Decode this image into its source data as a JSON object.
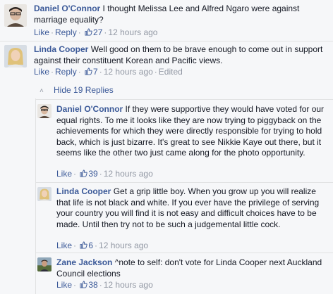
{
  "comments": [
    {
      "author": "Daniel O'Connor",
      "text": "I thought Melissa Lee and Alfred Ngaro were against marriage equality?",
      "like_label": "Like",
      "reply_label": "Reply",
      "likes": "27",
      "time": "12 hours ago"
    },
    {
      "author": "Linda Cooper",
      "text": "Well good on them to be brave enough to come out in support against their constituent Korean and Pacific views.",
      "like_label": "Like",
      "reply_label": "Reply",
      "likes": "7",
      "time": "12 hours ago",
      "edited": "Edited"
    }
  ],
  "hide_replies_label": "Hide 19 Replies",
  "replies": [
    {
      "author": "Daniel O'Connor",
      "text": "If they were supportive they would have voted for our equal rights. To me it looks like they are now trying to piggyback on the achievements for which they were directly responsible for trying to hold back, which is just bizarre. It's great to see Nikkie Kaye out there, but it seems like the other two just came along for the photo opportunity.",
      "like_label": "Like",
      "likes": "39",
      "time": "12 hours ago"
    },
    {
      "author": "Linda Cooper",
      "text": "Get a grip little boy. When you grow up you will realize that life is not black and white. If you ever have the privilege of serving your country you will find it is not easy and difficult choices have to be made. Until then try not to be such a judgemental little cock.",
      "like_label": "Like",
      "likes": "6",
      "time": "12 hours ago"
    },
    {
      "author": "Zane Jackson",
      "text": "^note to self: don't vote for Linda Cooper next Auckland Council elections",
      "like_label": "Like",
      "likes": "38",
      "time": "12 hours ago"
    }
  ],
  "colors": {
    "link": "#3b5998",
    "meta": "#9197a3",
    "background": "#f6f7f9"
  }
}
